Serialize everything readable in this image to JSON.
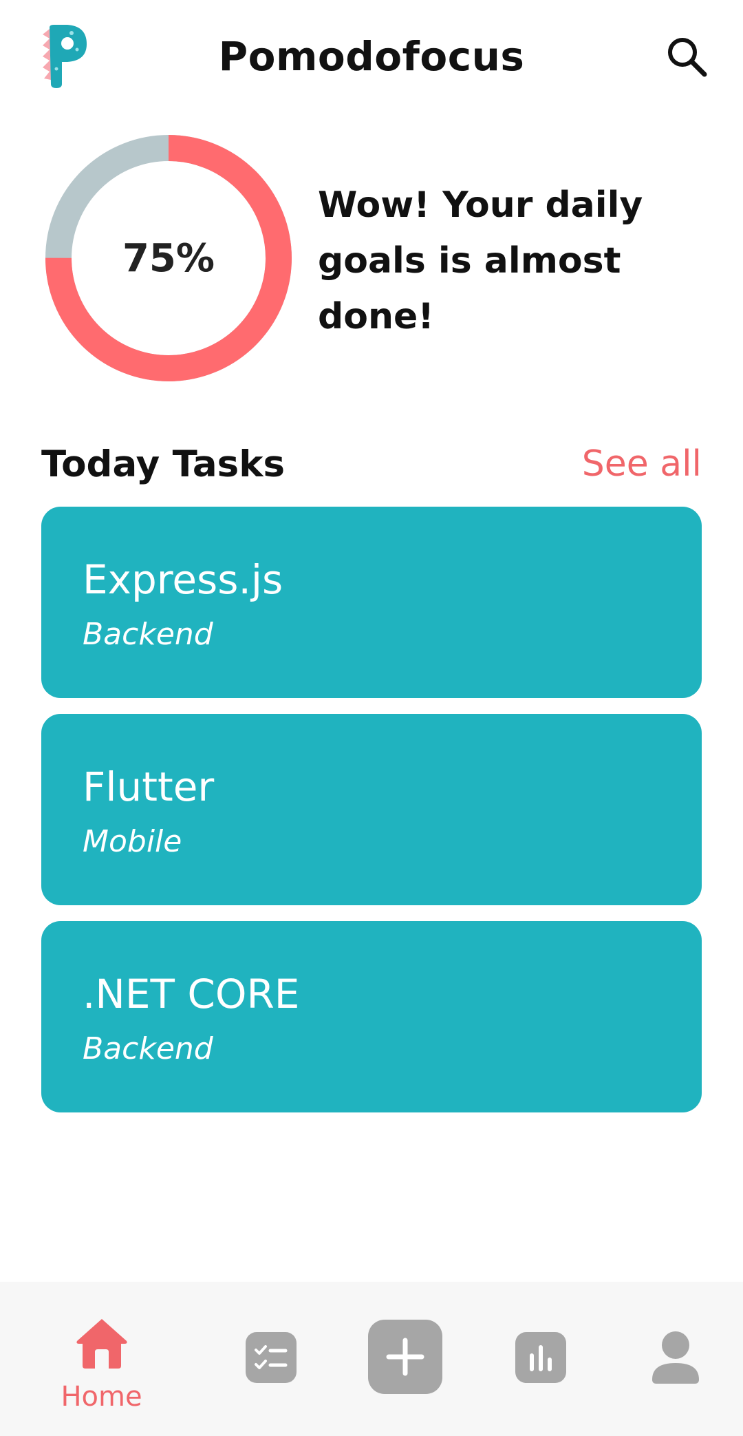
{
  "header": {
    "title": "Pomodofocus",
    "logo_icon": "pomodofocus-logo-icon",
    "search_icon": "search-icon"
  },
  "progress": {
    "percent_label": "75%",
    "percent_value": 0.75,
    "message": "Wow! Your daily goals is almost done!",
    "colors": {
      "complete": "#ff6b6f",
      "remaining": "#b7c7cb"
    }
  },
  "tasks": {
    "title": "Today Tasks",
    "see_all": "See all",
    "card_color": "#20b3bf",
    "items": [
      {
        "name": "Express.js",
        "category": "Backend"
      },
      {
        "name": "Flutter",
        "category": "Mobile"
      },
      {
        "name": ".NET CORE",
        "category": "Backend"
      }
    ]
  },
  "nav": {
    "active_color": "#f0666a",
    "inactive_color": "#a6a6a6",
    "items": [
      {
        "label": "Home",
        "icon": "home-icon"
      },
      {
        "icon": "task-list-icon"
      },
      {
        "icon": "add-icon"
      },
      {
        "icon": "stats-icon"
      },
      {
        "icon": "profile-icon"
      }
    ]
  }
}
